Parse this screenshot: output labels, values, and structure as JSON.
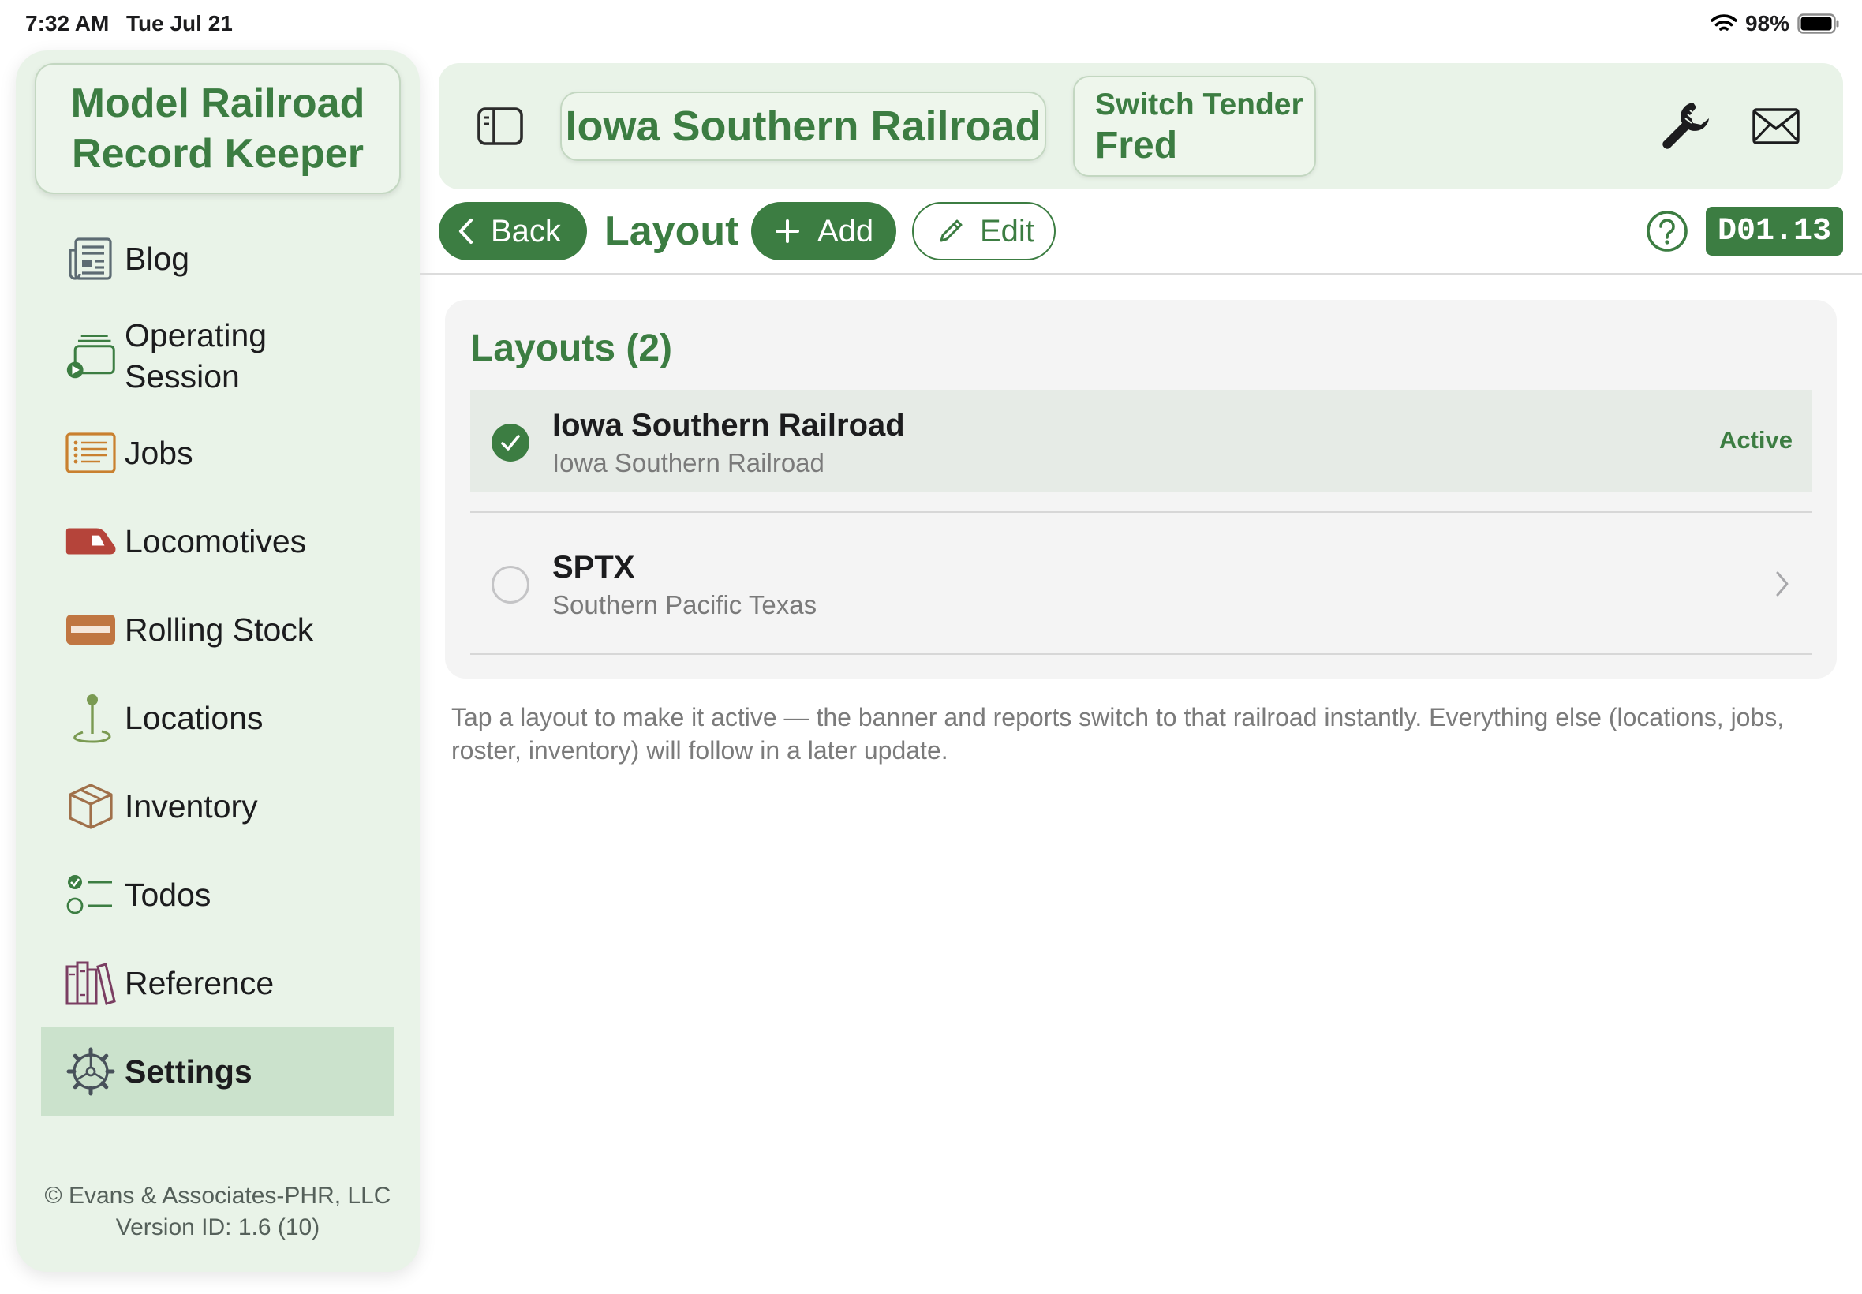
{
  "status_bar": {
    "time": "7:32 AM",
    "date": "Tue Jul 21",
    "battery": "98%"
  },
  "app": {
    "title": "Model Railroad Record Keeper"
  },
  "sidebar": {
    "items": [
      {
        "label": "Blog",
        "icon": "newspaper-icon"
      },
      {
        "label": "Operating Session",
        "icon": "operating-session-icon"
      },
      {
        "label": "Jobs",
        "icon": "list-icon"
      },
      {
        "label": "Locomotives",
        "icon": "locomotive-icon"
      },
      {
        "label": "Rolling Stock",
        "icon": "rolling-stock-icon"
      },
      {
        "label": "Locations",
        "icon": "map-pin-icon"
      },
      {
        "label": "Inventory",
        "icon": "box-icon"
      },
      {
        "label": "Todos",
        "icon": "checklist-icon"
      },
      {
        "label": "Reference",
        "icon": "books-icon"
      },
      {
        "label": "Settings",
        "icon": "gear-icon",
        "selected": true
      }
    ],
    "footer": {
      "copyright": "© Evans & Associates-PHR, LLC",
      "version": "Version ID: 1.6 (10)"
    }
  },
  "header": {
    "railroad": "Iowa Southern Railroad",
    "role_title": "Switch Tender",
    "role_name": "Fred"
  },
  "toolbar": {
    "back_label": "Back",
    "page_title": "Layout",
    "add_label": "Add",
    "edit_label": "Edit",
    "code": "D01.13"
  },
  "layouts": {
    "title": "Layouts (2)",
    "items": [
      {
        "name": "Iowa Southern Railroad",
        "subtitle": "Iowa Southern Railroad",
        "status": "Active",
        "active": true
      },
      {
        "name": "SPTX",
        "subtitle": "Southern Pacific Texas",
        "status": "",
        "active": false
      }
    ]
  },
  "hint": "Tap a layout to make it active — the banner and reports switch to that railroad instantly. Everything else (locations, jobs, roster, inventory) will follow in a later update.",
  "colors": {
    "accent": "#3c7d42",
    "sidebar_bg": "#e9f3e8",
    "selected_bg": "#cbe2cc",
    "locomotive": "#b5443a",
    "rolling_stock": "#c07642"
  }
}
